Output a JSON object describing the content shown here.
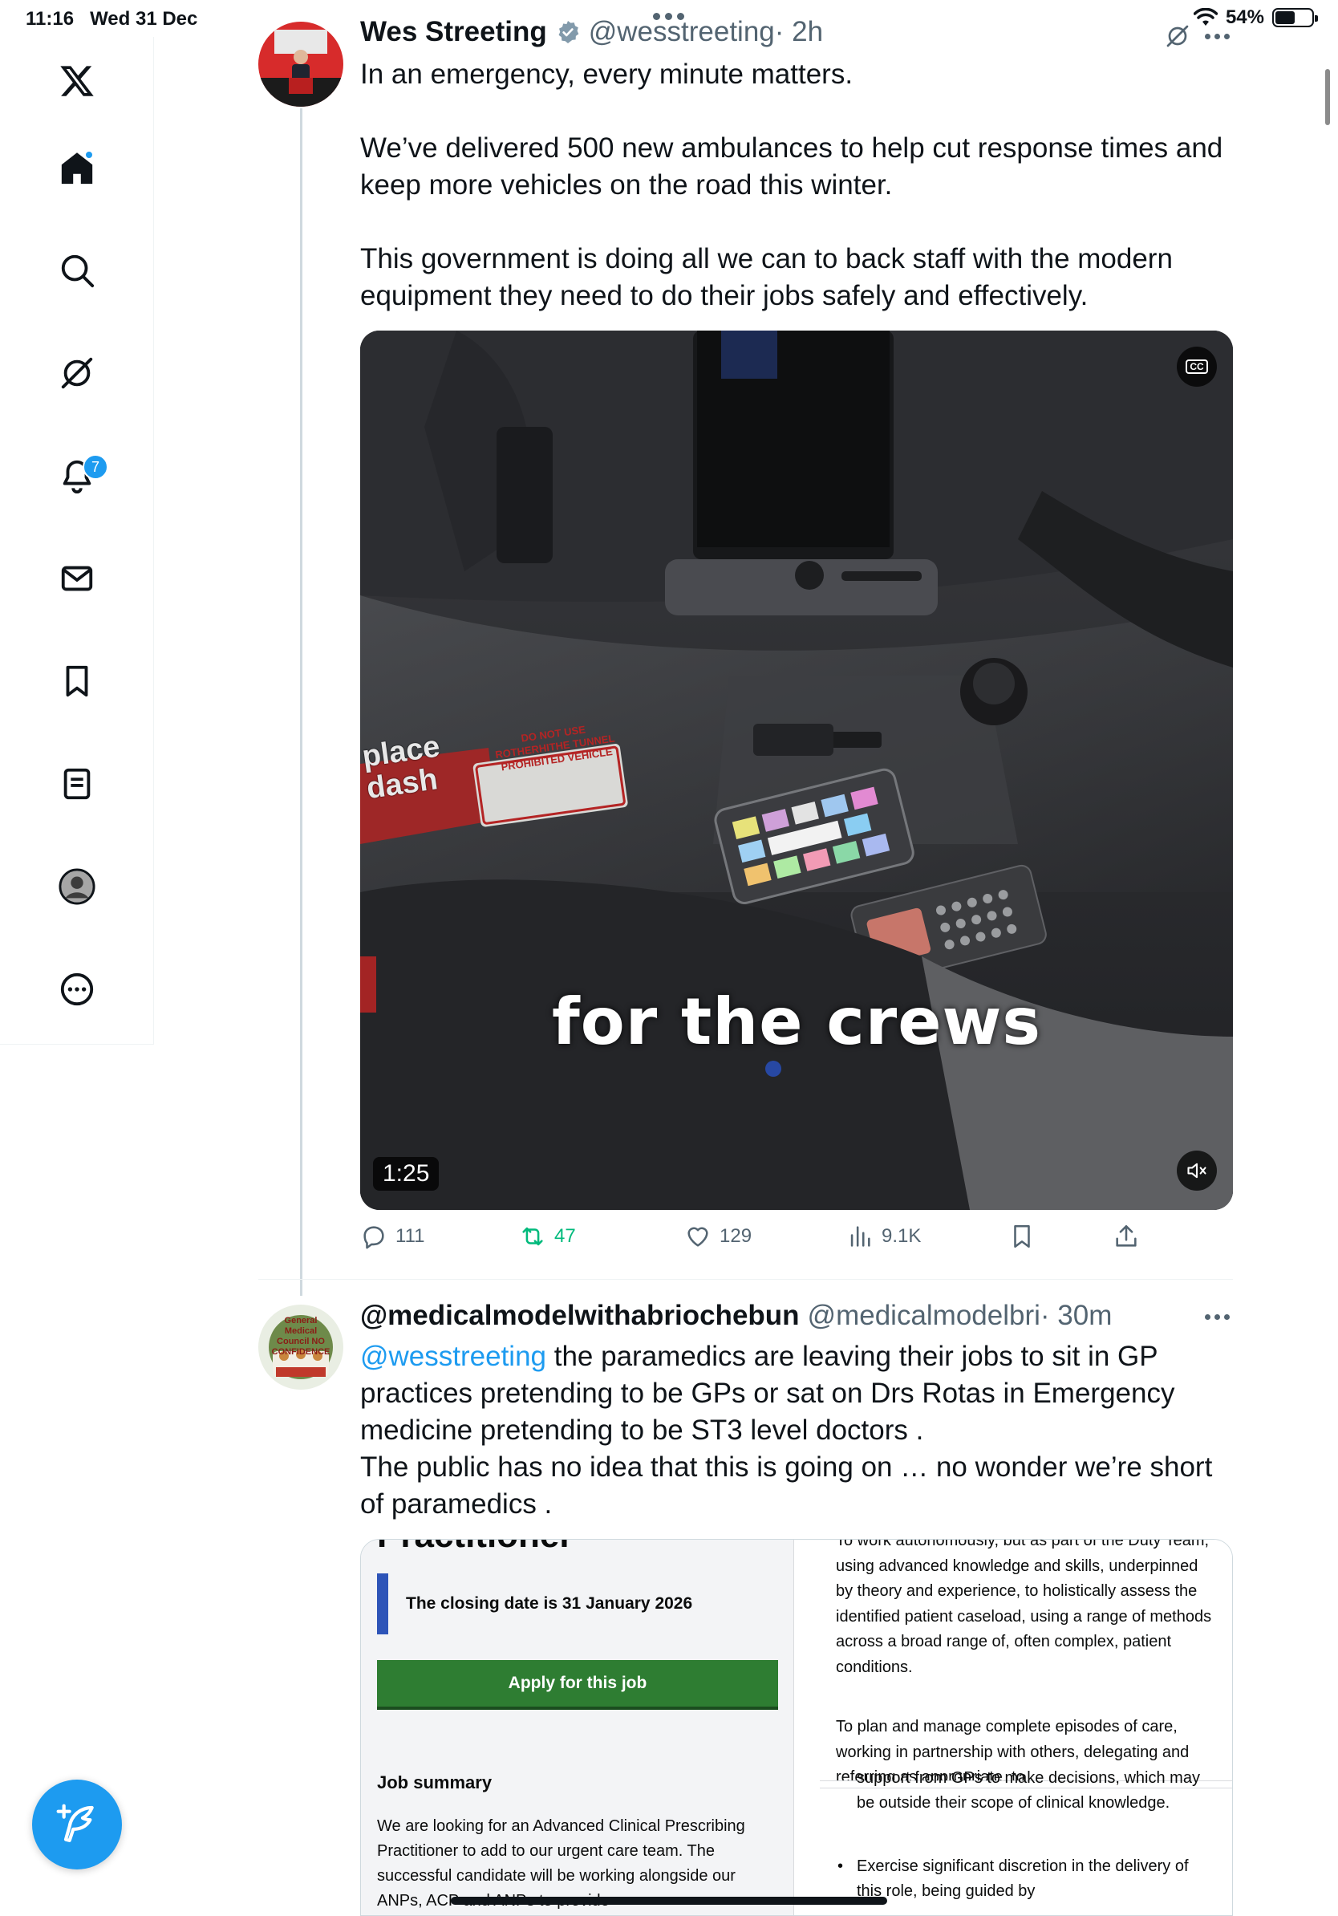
{
  "status_bar": {
    "time": "11:16",
    "date": "Wed 31 Dec",
    "battery": "54%",
    "battery_level": 0.54
  },
  "sidebar": {
    "items": [
      {
        "name": "x-logo-icon"
      },
      {
        "name": "home-icon",
        "has_dot": true
      },
      {
        "name": "search-icon"
      },
      {
        "name": "grok-icon"
      },
      {
        "name": "notifications-icon",
        "badge": "7"
      },
      {
        "name": "messages-icon"
      },
      {
        "name": "bookmarks-icon"
      },
      {
        "name": "lists-icon"
      },
      {
        "name": "profile-icon"
      },
      {
        "name": "more-icon"
      }
    ],
    "accent_color": "#1d9bf0"
  },
  "tweet1": {
    "display_name": "Wes Streeting",
    "handle": "@wesstreeting",
    "time": "· 2h",
    "text": "In an emergency, every minute matters.\n\nWe’ve delivered 500 new ambulances to help cut response times and keep more vehicles on the road this winter.\n\nThis government is doing all we can to back staff with the modern equipment they need to do their jobs safely and effectively.",
    "video": {
      "caption": "for the crews",
      "duration": "1:25",
      "cc": "CC",
      "sign_text": "DO NOT USE\nROTHERHITHE TUNNEL\nPROHIBITED VEHICLE",
      "sticker_text": "place\ndash"
    },
    "actions": {
      "replies": "111",
      "reposts": "47",
      "likes": "129",
      "views": "9.1K"
    }
  },
  "tweet2": {
    "display_name": "@medicalmodelwithabriochebun",
    "handle": "@medicalmodelbri",
    "time": "· 30m",
    "mention": "@wesstreeting",
    "text": " the paramedics are leaving their jobs to sit in GP practices pretending to be GPs or sat on Drs Rotas in Emergency medicine pretending to be ST3 level doctors .\nThe public has no idea that this is going on … no wonder we’re short of paramedics .",
    "avatar_text": "General Medical Council NO CONFIDENCE",
    "image": {
      "title_cut": "Practitioner",
      "closing_date": "The closing date is 31 January 2026",
      "apply_label": "Apply for this job",
      "job_summary_heading": "Job summary",
      "job_summary_text": "We are looking for an Advanced Clinical Prescribing Practitioner to add to our urgent care team. The successful candidate will be working alongside our ANPs, ACP and ANPs to provide",
      "right_p1": "To work autonomously, but as part of the Duty Team, using advanced knowledge and skills, underpinned by theory and experience, to holistically assess the identified patient caseload, using a range of methods across a broad range of, often complex, patient conditions.",
      "right_p2": "To plan and manage complete episodes of care, working in partnership with others, delegating and referring as appropriate, to",
      "right_p3": "support from GPs to make decisions, which may be outside their scope of clinical knowledge.",
      "right_li": "Exercise significant discretion in the delivery of this role, being guided by"
    }
  }
}
